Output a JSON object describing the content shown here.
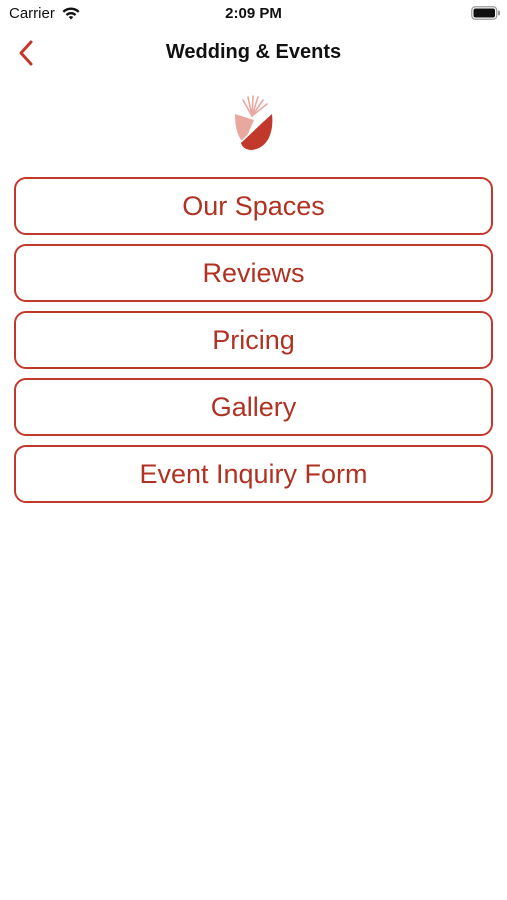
{
  "status_bar": {
    "carrier": "Carrier",
    "time": "2:09 PM",
    "wifi_icon": "wifi-icon",
    "battery_icon": "battery-icon"
  },
  "nav": {
    "back_icon": "chevron-left-icon",
    "title": "Wedding & Events"
  },
  "logo": {
    "icon": "sunrise-petal-logo",
    "colors": {
      "dark": "#c0392b",
      "light": "#e8a8a0"
    }
  },
  "menu": {
    "items": [
      {
        "label": "Our Spaces"
      },
      {
        "label": "Reviews"
      },
      {
        "label": "Pricing"
      },
      {
        "label": "Gallery"
      },
      {
        "label": "Event Inquiry Form"
      }
    ]
  },
  "colors": {
    "accent": "#c0392b",
    "text_accent": "#b03222",
    "background": "#ffffff"
  }
}
